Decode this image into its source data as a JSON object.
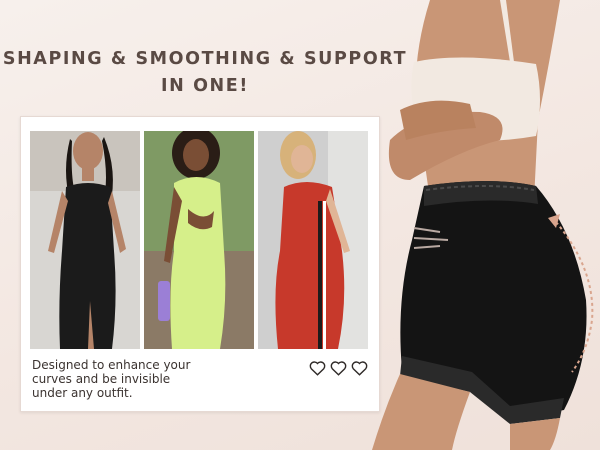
{
  "headline": {
    "line1": "SHAPING & SMOOTHING & SUPPORT",
    "line2": "IN ONE!"
  },
  "card": {
    "caption": [
      "Designed to enhance your",
      "curves and be invisible",
      "under any outfit."
    ],
    "photos": [
      {
        "dress_color": "#1b1b1b",
        "background": "#d8d6d2"
      },
      {
        "dress_color": "#d6ef8a",
        "background": "#8b7a66"
      },
      {
        "dress_color": "#c7392b",
        "background": "#cfcfcf"
      }
    ],
    "heart_count": 3
  },
  "colors": {
    "headline_text": "#5a4a44",
    "caption_text": "#3b3330",
    "skin": "#c99676",
    "shapewear": "#141414",
    "bra": "#f2e9e1",
    "curve_arrow": "#d9a58e"
  }
}
